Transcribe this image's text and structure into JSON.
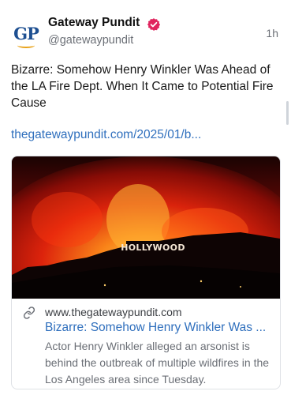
{
  "post": {
    "author": {
      "name": "Gateway Pundit",
      "handle": "@gatewaypundit",
      "avatar_text": "GP",
      "verified_icon": "verified-badge-icon",
      "badge_color": "#e0245e"
    },
    "time": "1h",
    "text": "Bizarre: Somehow Henry Winkler Was Ahead of the LA Fire Dept. When It Came to Potential Fire Cause",
    "link_text": "thegatewaypundit.com/2025/01/b...",
    "link_color": "#2f6fbd"
  },
  "card": {
    "image_sign_text": "HOLLYWOOD",
    "link_icon": "link-icon",
    "domain": "www.thegatewaypundit.com",
    "title": "Bizarre: Somehow Henry Winkler Was ...",
    "description": "Actor Henry Winkler alleged an arsonist is behind the outbreak of multiple wildfires in the Los Angeles area since Tuesday."
  }
}
